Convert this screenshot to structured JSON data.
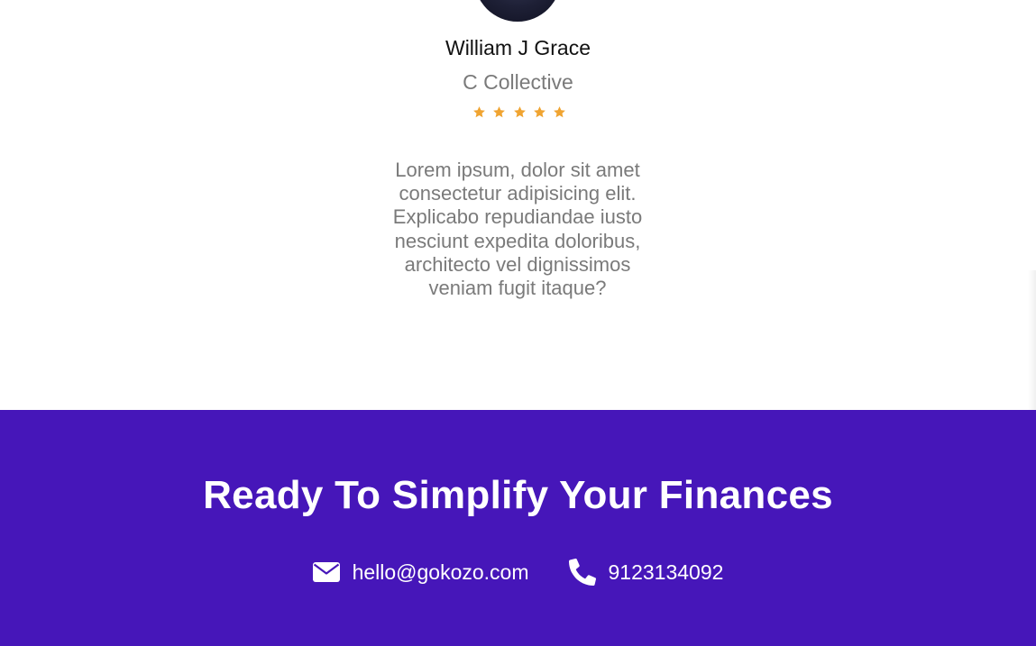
{
  "testimonial": {
    "name": "William J Grace",
    "company": "C Collective",
    "rating": 5,
    "rating_max": 5,
    "quote": "Lorem ipsum, dolor sit amet consectetur adipisicing elit. Explicabo repudiandae iusto nesciunt expedita doloribus, architecto vel dignissimos veniam fugit itaque?"
  },
  "cta": {
    "title": "Ready To Simplify Your Finances",
    "email": "hello@gokozo.com",
    "phone": "9123134092",
    "email_icon": "envelope-icon",
    "phone_icon": "phone-icon"
  },
  "colors": {
    "cta_background": "#4616b9",
    "star": "#f0a431",
    "muted_text": "#7a7a7a"
  }
}
